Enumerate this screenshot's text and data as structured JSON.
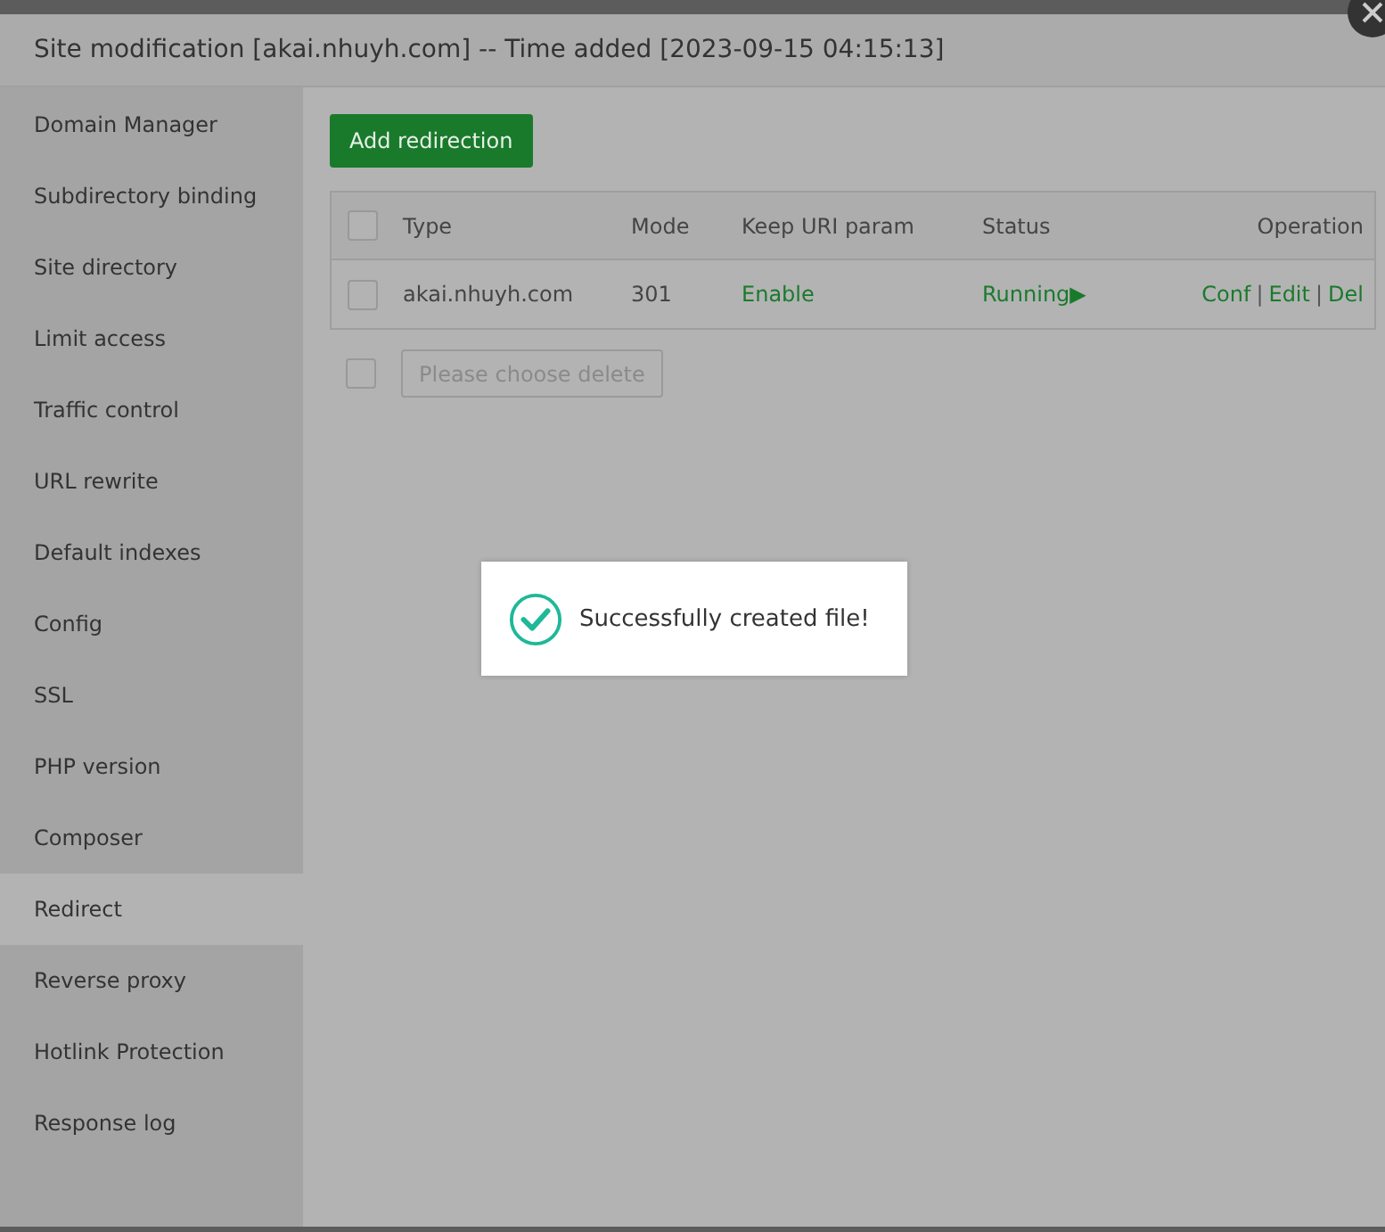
{
  "dialog": {
    "title": "Site modification [akai.nhuyh.com] -- Time added [2023-09-15 04:15:13]"
  },
  "sidebar": {
    "items": [
      {
        "label": "Domain Manager",
        "selected": false
      },
      {
        "label": "Subdirectory binding",
        "selected": false
      },
      {
        "label": "Site directory",
        "selected": false
      },
      {
        "label": "Limit access",
        "selected": false
      },
      {
        "label": "Traffic control",
        "selected": false
      },
      {
        "label": "URL rewrite",
        "selected": false
      },
      {
        "label": "Default indexes",
        "selected": false
      },
      {
        "label": "Config",
        "selected": false
      },
      {
        "label": "SSL",
        "selected": false
      },
      {
        "label": "PHP version",
        "selected": false
      },
      {
        "label": "Composer",
        "selected": false
      },
      {
        "label": "Redirect",
        "selected": true
      },
      {
        "label": "Reverse proxy",
        "selected": false
      },
      {
        "label": "Hotlink Protection",
        "selected": false
      },
      {
        "label": "Response log",
        "selected": false
      }
    ]
  },
  "add_button": "Add redirection",
  "table": {
    "select_all": {
      "checked": false
    },
    "columns": [
      "Type",
      "Mode",
      "Keep URI param",
      "Status",
      "Operation"
    ],
    "rows": [
      {
        "checked": false,
        "type": "akai.nhuyh.com",
        "mode": "301",
        "keep_uri": "Enable",
        "status": "Running",
        "status_icon": "▶",
        "operations": [
          "Conf",
          "Edit",
          "Del"
        ],
        "separator": "|"
      }
    ]
  },
  "footer": {
    "checked": false,
    "delete_button": {
      "label": "Please choose delete",
      "disabled": true
    }
  },
  "toast": {
    "message": "Successfully created file!"
  }
}
